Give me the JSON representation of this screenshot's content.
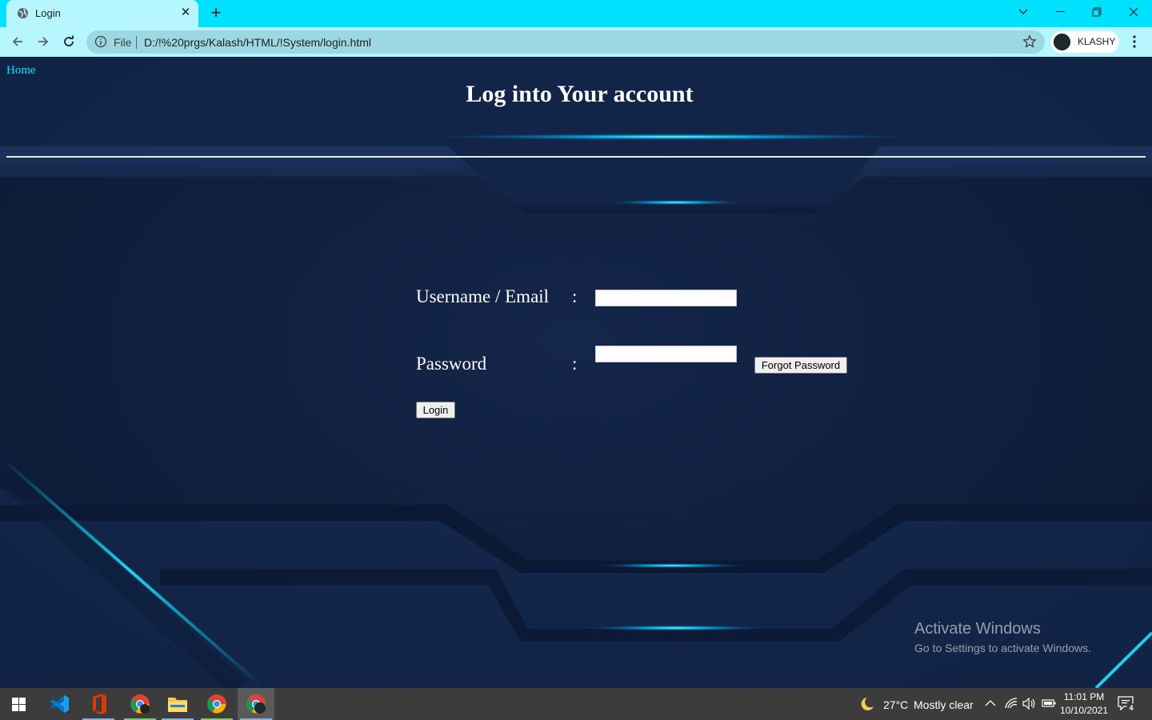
{
  "browser": {
    "tab_title": "Login",
    "omnibox": {
      "scheme_label": "File",
      "url": "D:/!%20prgs/Kalash/HTML/!System/login.html"
    },
    "profile_name": "KLASHY"
  },
  "page": {
    "home_link": "Home",
    "title": "Log into Your account",
    "form": {
      "username_label": "Username / Email",
      "password_label": "Password",
      "colon": ":",
      "username_value": "",
      "password_value": "",
      "forgot_button": "Forgot Password",
      "login_button": "Login"
    }
  },
  "watermark": {
    "title": "Activate Windows",
    "subtitle": "Go to Settings to activate Windows."
  },
  "taskbar": {
    "apps": [
      "windows-start",
      "vscode",
      "office",
      "chrome-profile",
      "file-explorer",
      "chrome",
      "chrome-active"
    ],
    "weather": {
      "temp": "27°C",
      "condition": "Mostly clear"
    },
    "clock": {
      "time": "11:01 PM",
      "date": "10/10/2021"
    },
    "notification_count": "4"
  },
  "colors": {
    "tab_strip": "#00e1fd",
    "toolbar": "#b5f6ff",
    "page_bg": "#0d1b36",
    "accent_glow": "#00cfff",
    "home_link": "#00e5ff"
  }
}
